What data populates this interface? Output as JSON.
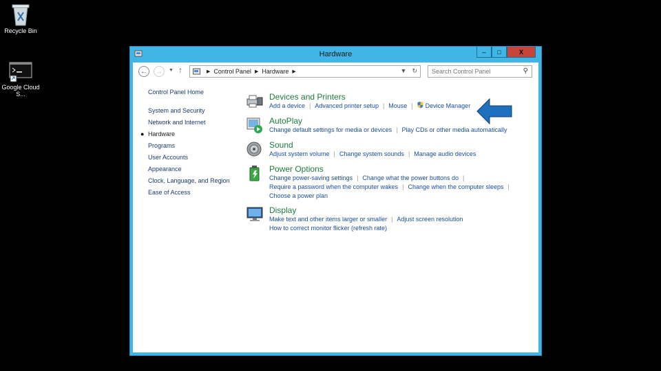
{
  "desktop": {
    "icons": [
      {
        "label": "Recycle Bin",
        "icon": "recycle-bin-icon"
      },
      {
        "label": "Google Cloud S...",
        "icon": "terminal-icon"
      }
    ]
  },
  "window": {
    "title": "Hardware",
    "buttons": {
      "minimize": "–",
      "maximize": "□",
      "close": "X"
    }
  },
  "address": {
    "crumbs": [
      "Control Panel",
      "Hardware"
    ],
    "search_placeholder": "Search Control Panel"
  },
  "left_nav": {
    "home": "Control Panel Home",
    "items": [
      {
        "label": "System and Security"
      },
      {
        "label": "Network and Internet"
      },
      {
        "label": "Hardware",
        "current": true
      },
      {
        "label": "Programs"
      },
      {
        "label": "User Accounts"
      },
      {
        "label": "Appearance"
      },
      {
        "label": "Clock, Language, and Region"
      },
      {
        "label": "Ease of Access"
      }
    ]
  },
  "categories": [
    {
      "title": "Devices and Printers",
      "links": [
        "Add a device",
        "Advanced printer setup",
        "Mouse",
        "Device Manager"
      ]
    },
    {
      "title": "AutoPlay",
      "links": [
        "Change default settings for media or devices",
        "Play CDs or other media automatically"
      ]
    },
    {
      "title": "Sound",
      "links": [
        "Adjust system volume",
        "Change system sounds",
        "Manage audio devices"
      ]
    },
    {
      "title": "Power Options",
      "links": [
        "Change power-saving settings",
        "Change what the power buttons do",
        "Require a password when the computer wakes",
        "Change when the computer sleeps",
        "Choose a power plan"
      ]
    },
    {
      "title": "Display",
      "links": [
        "Make text and other items larger or smaller",
        "Adjust screen resolution",
        "How to correct monitor flicker (refresh rate)"
      ]
    }
  ],
  "colors": {
    "window_frame": "#3fb6e6",
    "category_title": "#1e7a3c",
    "link": "#1a4fa0",
    "annotation_arrow": "#1f6fbf"
  }
}
